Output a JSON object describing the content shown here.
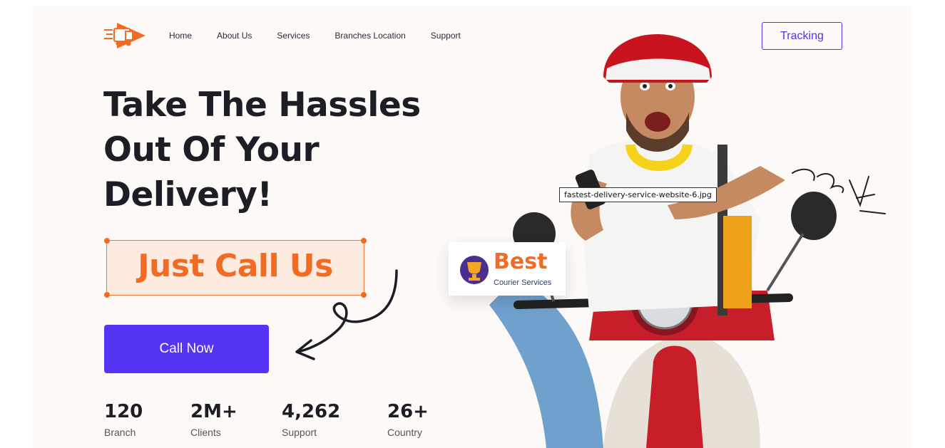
{
  "nav": {
    "items": [
      "Home",
      "About Us",
      "Services",
      "Branches Location",
      "Support"
    ],
    "tracking_label": "Tracking"
  },
  "hero": {
    "headline": [
      "Take The Hassles",
      "Out Of Your",
      "Delivery!"
    ],
    "callout": "Just Call Us",
    "cta_label": "Call Now"
  },
  "stats": [
    {
      "value": "120",
      "label": "Branch"
    },
    {
      "value": "2M+",
      "label": "Clients"
    },
    {
      "value": "4,262",
      "label": "Support"
    },
    {
      "value": "26+",
      "label": "Country"
    }
  ],
  "badge": {
    "title": "Best",
    "subtitle": "Courier Services"
  },
  "tooltip": "fastest-delivery-service-website-6.jpg",
  "colors": {
    "accent": "#5534f5",
    "orange": "#f26b25",
    "text": "#1d1d26",
    "background": "#fdf9f7"
  },
  "icons": {
    "logo": "delivery-truck-logo-icon",
    "trophy": "trophy-icon"
  }
}
